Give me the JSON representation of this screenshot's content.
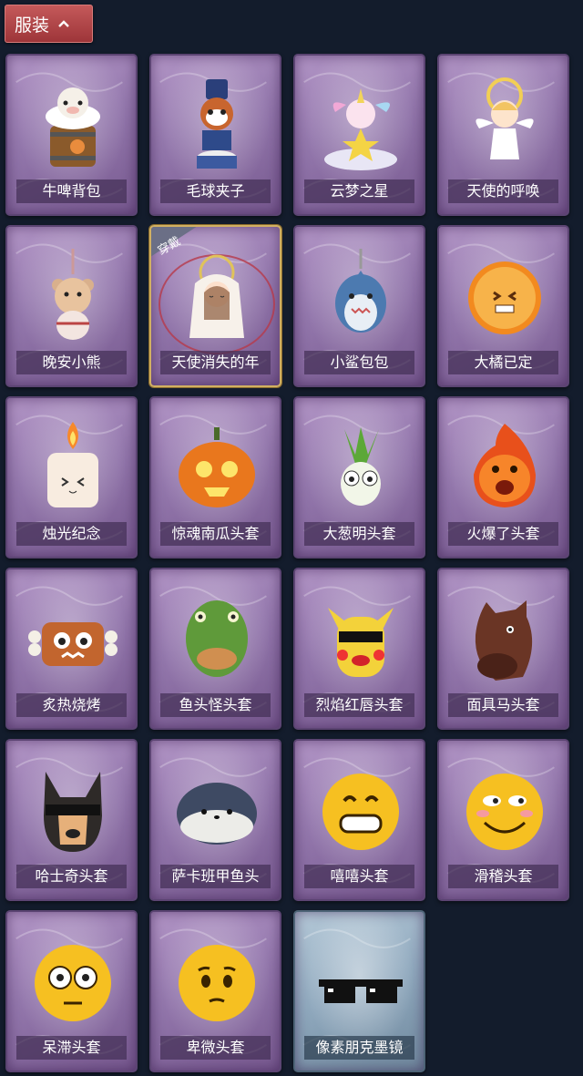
{
  "header": {
    "title": "服装"
  },
  "items": [
    {
      "name": "牛啤背包",
      "icon": "cow-barrel-backpack-icon",
      "equipped": false,
      "rarity": "purple"
    },
    {
      "name": "毛球夹子",
      "icon": "raccoon-drummer-clip-icon",
      "equipped": false,
      "rarity": "purple"
    },
    {
      "name": "云梦之星",
      "icon": "unicorn-cloud-star-icon",
      "equipped": false,
      "rarity": "purple"
    },
    {
      "name": "天使的呼唤",
      "icon": "angel-halo-icon",
      "equipped": false,
      "rarity": "purple"
    },
    {
      "name": "晚安小熊",
      "icon": "teddy-bear-keychain-icon",
      "equipped": false,
      "rarity": "purple"
    },
    {
      "name": "天使消失的年",
      "icon": "angel-veil-girl-icon",
      "equipped": true,
      "rarity": "purple",
      "badge": "穿戴"
    },
    {
      "name": "小鲨包包",
      "icon": "shark-bag-icon",
      "equipped": false,
      "rarity": "purple"
    },
    {
      "name": "大橘已定",
      "icon": "orange-slice-icon",
      "equipped": false,
      "rarity": "purple"
    },
    {
      "name": "烛光纪念",
      "icon": "candle-icon",
      "equipped": false,
      "rarity": "purple"
    },
    {
      "name": "惊魂南瓜头套",
      "icon": "pumpkin-head-icon",
      "equipped": false,
      "rarity": "purple"
    },
    {
      "name": "大葱明头套",
      "icon": "green-onion-head-icon",
      "equipped": false,
      "rarity": "purple"
    },
    {
      "name": "火爆了头套",
      "icon": "fire-head-icon",
      "equipped": false,
      "rarity": "purple"
    },
    {
      "name": "炙热烧烤",
      "icon": "meat-bone-icon",
      "equipped": false,
      "rarity": "purple"
    },
    {
      "name": "鱼头怪头套",
      "icon": "fish-head-mask-icon",
      "equipped": false,
      "rarity": "purple"
    },
    {
      "name": "烈焰红唇头套",
      "icon": "pikachu-lips-mask-icon",
      "equipped": false,
      "rarity": "purple"
    },
    {
      "name": "面具马头套",
      "icon": "horse-head-mask-icon",
      "equipped": false,
      "rarity": "purple"
    },
    {
      "name": "哈士奇头套",
      "icon": "husky-sunglasses-icon",
      "equipped": false,
      "rarity": "purple"
    },
    {
      "name": "萨卡班甲鱼头",
      "icon": "sacabambaspis-head-icon",
      "equipped": false,
      "rarity": "purple"
    },
    {
      "name": "嘻嘻头套",
      "icon": "grinning-emoji-icon",
      "equipped": false,
      "rarity": "purple"
    },
    {
      "name": "滑稽头套",
      "icon": "funny-emoji-icon",
      "equipped": false,
      "rarity": "purple"
    },
    {
      "name": "呆滞头套",
      "icon": "dazed-emoji-icon",
      "equipped": false,
      "rarity": "purple"
    },
    {
      "name": "卑微头套",
      "icon": "timid-emoji-icon",
      "equipped": false,
      "rarity": "purple"
    },
    {
      "name": "像素朋克墨镜",
      "icon": "pixel-sunglasses-icon",
      "equipped": false,
      "rarity": "blue"
    }
  ]
}
